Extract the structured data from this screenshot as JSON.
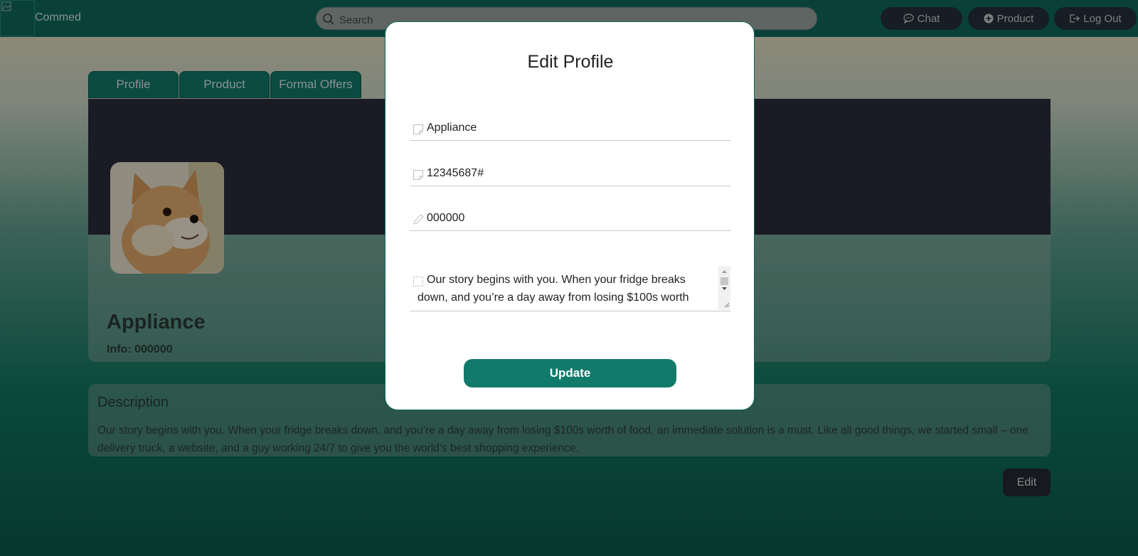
{
  "header": {
    "brand": "Commed",
    "search": {
      "placeholder": "Search",
      "value": ""
    },
    "nav": [
      {
        "label": "Chat",
        "icon": "chat-bubble-icon"
      },
      {
        "label": "Product",
        "icon": "plus-circle-icon"
      },
      {
        "label": "Log Out",
        "icon": "logout-icon"
      }
    ]
  },
  "tabs": [
    {
      "label": "Profile"
    },
    {
      "label": "Product"
    },
    {
      "label": "Formal Offers"
    }
  ],
  "profile": {
    "name": "Appliance",
    "info": "Info: 000000"
  },
  "description": {
    "title": "Description",
    "text": "Our story begins with you. When your fridge breaks down, and you’re a day away from losing $100s worth of food, an immediate solution is a must. Like all good things, we started small – one delivery truck, a website, and a guy working 24/7 to give you the world’s best shopping experience."
  },
  "edit_label": "Edit",
  "modal": {
    "title": "Edit Profile",
    "fields": [
      {
        "value": "Appliance",
        "icon": "note-icon"
      },
      {
        "value": "12345687#",
        "icon": "note-icon"
      },
      {
        "value": "000000",
        "icon": "pencil-icon"
      }
    ],
    "textarea": {
      "value": "Our story begins with you. When your fridge breaks down, and you’re a day away from losing $100s worth",
      "icon": "checkbox-icon"
    },
    "update_label": "Update"
  },
  "colors": {
    "header_bg": "#0f6a5c",
    "accent": "#117a6b",
    "dark_button": "#26303a",
    "banner": "#2a2c3a"
  }
}
